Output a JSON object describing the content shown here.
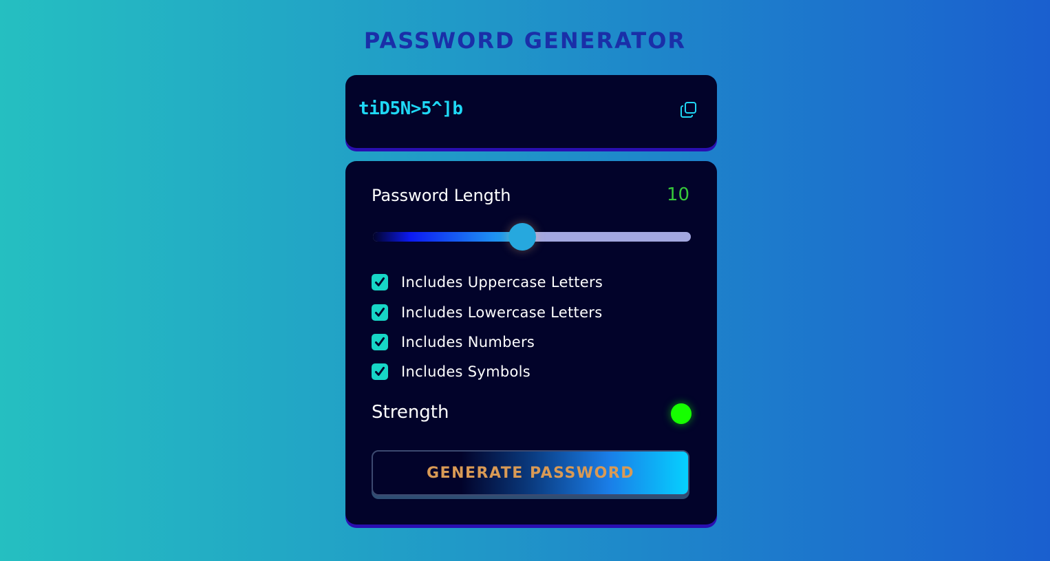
{
  "app": {
    "title": "PASSWORD GENERATOR"
  },
  "password": {
    "value": "tiD5N>5^]b",
    "copy_icon": "copy-icon"
  },
  "length": {
    "label": "Password Length",
    "value": "10",
    "slider_fraction": 0.47
  },
  "options": [
    {
      "label": "Includes Uppercase Letters",
      "checked": true
    },
    {
      "label": "Includes Lowercase Letters",
      "checked": true
    },
    {
      "label": "Includes Numbers",
      "checked": true
    },
    {
      "label": "Includes Symbols",
      "checked": true
    }
  ],
  "strength": {
    "label": "Strength",
    "indicator_color": "#16ff00"
  },
  "generate": {
    "label": "GENERATE PASSWORD"
  },
  "colors": {
    "title": "#1a2fa8",
    "card_bg": "#02032a",
    "password_text": "#1fd8f5",
    "length_value": "#37c83a",
    "checkbox": "#17d6c6",
    "button_text": "#d99a55"
  }
}
